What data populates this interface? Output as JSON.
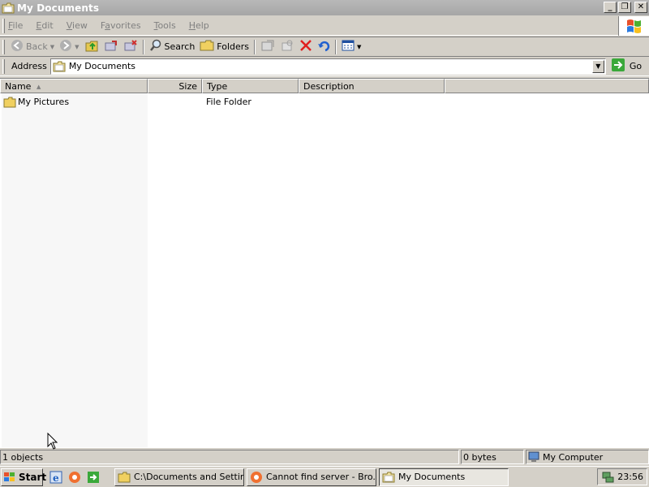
{
  "window": {
    "title": "My Documents",
    "buttons": {
      "minimize": "_",
      "restore": "❐",
      "close": "✕"
    }
  },
  "menu": {
    "items": [
      {
        "key": "F",
        "rest": "ile"
      },
      {
        "key": "E",
        "rest": "dit"
      },
      {
        "key": "V",
        "rest": "iew"
      },
      {
        "key": "a",
        "pre": "F",
        "rest": "vorites"
      },
      {
        "key": "T",
        "rest": "ools"
      },
      {
        "key": "H",
        "rest": "elp"
      }
    ]
  },
  "toolbar": {
    "back_label": "Back",
    "search_label": "Search",
    "folders_label": "Folders"
  },
  "address": {
    "label": "Address",
    "value": "My Documents",
    "go_label": "Go"
  },
  "listview": {
    "columns": [
      "Name",
      "Size",
      "Type",
      "Description"
    ],
    "rows": [
      {
        "name": "My Pictures",
        "size": "",
        "type": "File Folder",
        "description": ""
      }
    ]
  },
  "status": {
    "objects": "1 objects",
    "size": "0 bytes",
    "zone": "My Computer"
  },
  "taskbar": {
    "start_label": "Start",
    "tasks": [
      {
        "label": "C:\\Documents and Settin...",
        "active": false
      },
      {
        "label": "Cannot find server - Bro...",
        "active": false
      },
      {
        "label": "My Documents",
        "active": true
      }
    ],
    "clock": "23:56"
  },
  "colors": {
    "titlebar": "#a6a6a6",
    "face": "#d4d0c8",
    "folder": "#f0d060"
  }
}
